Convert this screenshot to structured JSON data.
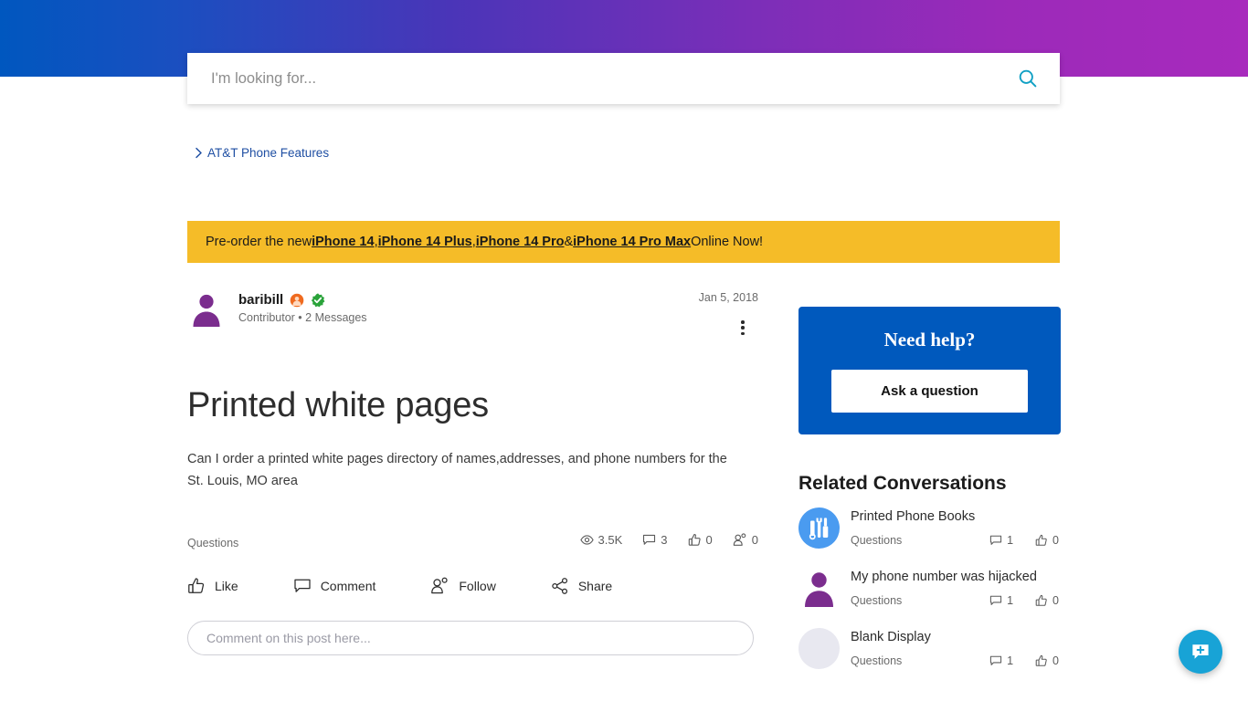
{
  "theme": {
    "gradient_start": "#0057bf",
    "gradient_end": "#a82abd",
    "banner_bg": "#f5bc28",
    "help_card_bg": "#0059bd",
    "fab_bg": "#18a3d6",
    "link_blue": "#1f4fa3",
    "search_icon": "#10a0c4",
    "avatar_purple": "#7b2d8e"
  },
  "search": {
    "placeholder": "I'm looking for...",
    "value": "",
    "icon": "search-icon"
  },
  "breadcrumb": {
    "chevron": "chevron-right-icon",
    "label": "AT&T Phone Features"
  },
  "promo": {
    "prefix": "Pre-order the new ",
    "links": [
      "iPhone 14",
      "iPhone 14 Plus",
      "iPhone 14 Pro",
      "iPhone 14 Pro Max"
    ],
    "sep1": ", ",
    "sep2": ", ",
    "sep3": " & ",
    "suffix": " Online Now!"
  },
  "post": {
    "author": "baribill",
    "author_badges": [
      "rank-badge-orange",
      "verified-badge-green"
    ],
    "author_role": "Contributor",
    "author_messages": "2 Messages",
    "author_sub": "Contributor • 2 Messages",
    "date": "Jan 5, 2018",
    "menu_icon": "kebab-menu-icon",
    "title": "Printed white pages",
    "body": "Can I order a printed white pages directory of names,addresses, and phone numbers for the St. Louis, MO area",
    "topic": "Questions",
    "stats": [
      {
        "icon": "eye-icon",
        "value": "3.5K",
        "name": "views"
      },
      {
        "icon": "comment-icon",
        "value": "3",
        "name": "comments"
      },
      {
        "icon": "thumbs-up-icon",
        "value": "0",
        "name": "likes"
      },
      {
        "icon": "followers-icon",
        "value": "0",
        "name": "followers"
      }
    ],
    "actions": [
      {
        "icon": "thumbs-up-icon",
        "label": "Like"
      },
      {
        "icon": "comment-icon",
        "label": "Comment"
      },
      {
        "icon": "followers-icon",
        "label": "Follow"
      },
      {
        "icon": "share-icon",
        "label": "Share"
      }
    ],
    "comment_placeholder": "Comment on this post here...",
    "comment_value": ""
  },
  "sidebar": {
    "help_title": "Need help?",
    "ask_button": "Ask a question",
    "related_title": "Related Conversations",
    "related": [
      {
        "avatar": "tools-icon",
        "title": "Printed Phone Books",
        "category": "Questions",
        "comments": "1",
        "likes": "0"
      },
      {
        "avatar": "person-icon",
        "title": "My phone number was hijacked",
        "category": "Questions",
        "comments": "1",
        "likes": "0"
      },
      {
        "avatar": "blank-avatar-icon",
        "title": "Blank Display",
        "category": "Questions",
        "comments": "1",
        "likes": "0"
      }
    ]
  },
  "fab": {
    "icon": "new-post-icon",
    "label": ""
  }
}
